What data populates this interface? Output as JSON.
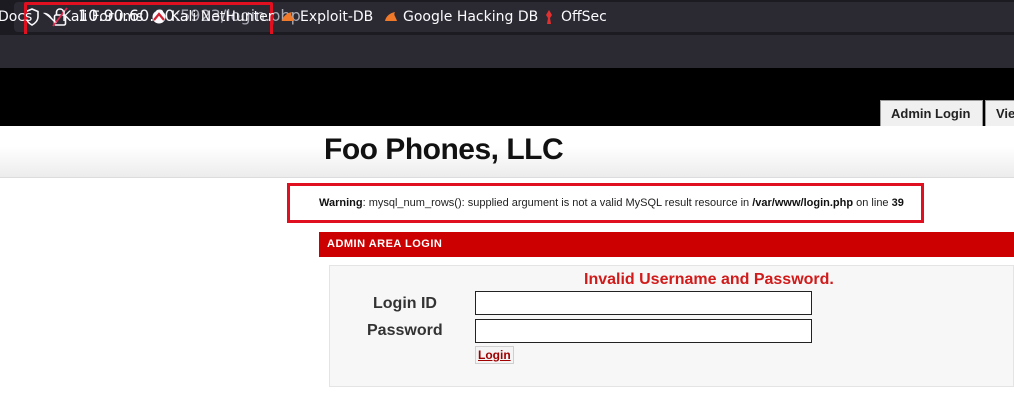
{
  "browser": {
    "url_host": "10.90.60.80",
    "url_rest": ":5923/login.php",
    "bookmarks": [
      {
        "label": "Docs",
        "icon": "docs"
      },
      {
        "label": "Kali Forums",
        "icon": "kali-dragon-icon"
      },
      {
        "label": "Kali NetHunter",
        "icon": "nethunter-icon"
      },
      {
        "label": "Exploit-DB",
        "icon": "exploit-db-icon"
      },
      {
        "label": "Google Hacking DB",
        "icon": "ghdb-icon"
      },
      {
        "label": "OffSec",
        "icon": "offsec-icon"
      }
    ],
    "highlight_color": "#e01020"
  },
  "site": {
    "tabs": [
      {
        "label": "Admin Login"
      },
      {
        "label": "Vie"
      }
    ],
    "title": "Foo Phones, LLC"
  },
  "warning": {
    "label": "Warning",
    "message": ": mysql_num_rows(): supplied argument is not a valid MySQL result resource in ",
    "path": "/var/www/login.php",
    "on_line": " on line ",
    "line": "39"
  },
  "admin": {
    "bar_title": "ADMIN AREA LOGIN",
    "bar_color": "#cc0000",
    "error": "Invalid Username and Password.",
    "login_id_label": "Login ID",
    "password_label": "Password",
    "login_id_value": "",
    "password_value": "",
    "login_button": "Login"
  }
}
